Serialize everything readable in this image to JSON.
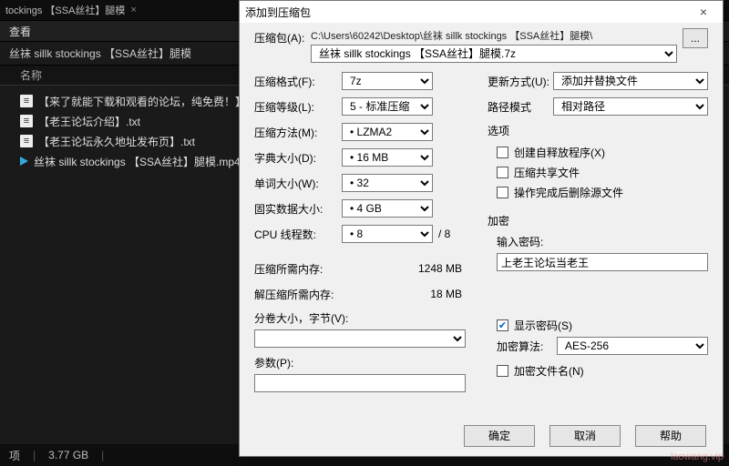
{
  "bg": {
    "window_title": "tockings  【SSA丝社】腿模",
    "close_glyph": "×",
    "menu_view": "查看",
    "help_glyph": "?",
    "path_text": "丝袜 sillk stockings  【SSA丝社】腿模",
    "col_name": "名称",
    "files": [
      {
        "type": "txt",
        "name": "【来了就能下载和观看的论坛，纯免费！】.txt"
      },
      {
        "type": "txt",
        "name": "【老王论坛介绍】.txt"
      },
      {
        "type": "txt",
        "name": "【老王论坛永久地址发布页】.txt"
      },
      {
        "type": "mp4",
        "name": "丝袜 sillk stockings  【SSA丝社】腿模.mp4"
      }
    ],
    "status_items": "项",
    "status_size": "3.77 GB"
  },
  "dlg": {
    "title": "添加到压缩包",
    "close_glyph": "×",
    "archive_label": "压缩包(A):",
    "archive_path": "C:\\Users\\60242\\Desktop\\丝袜 sillk stockings 【SSA丝社】腿模\\",
    "archive_value": "丝袜 sillk stockings 【SSA丝社】腿模.7z",
    "browse_glyph": "...",
    "rows": {
      "format": {
        "label": "压缩格式(F):",
        "value": "7z"
      },
      "level": {
        "label": "压缩等级(L):",
        "value": "5 - 标准压缩"
      },
      "method": {
        "label": "压缩方法(M):",
        "value": "LZMA2",
        "star": true
      },
      "dict": {
        "label": "字典大小(D):",
        "value": "16 MB",
        "star": true
      },
      "word": {
        "label": "单词大小(W):",
        "value": "32",
        "star": true
      },
      "solid": {
        "label": "固实数据大小:",
        "value": "4 GB",
        "star": true
      },
      "threads": {
        "label": "CPU 线程数:",
        "value": "8",
        "star": true,
        "suffix": "/ 8"
      },
      "mem_comp": {
        "label": "压缩所需内存:",
        "value": "1248 MB"
      },
      "mem_decomp": {
        "label": "解压缩所需内存:",
        "value": "18 MB"
      },
      "split": {
        "label": "分卷大小，字节(V):"
      },
      "params": {
        "label": "参数(P):"
      }
    },
    "right": {
      "update_label": "更新方式(U):",
      "update_value": "添加并替换文件",
      "pathmode_label": "路径模式",
      "pathmode_value": "相对路径",
      "options_title": "选项",
      "opt_sfx": "创建自释放程序(X)",
      "opt_share": "压缩共享文件",
      "opt_delete": "操作完成后删除源文件",
      "encrypt_title": "加密",
      "pwd_label": "输入密码:",
      "pwd_value": "上老王论坛当老王",
      "show_pwd": "显示密码(S)",
      "algo_label": "加密算法:",
      "algo_value": "AES-256",
      "enc_names": "加密文件名(N)"
    },
    "buttons": {
      "ok": "确定",
      "cancel": "取消",
      "help": "帮助"
    }
  },
  "watermark": "laowang.vip"
}
